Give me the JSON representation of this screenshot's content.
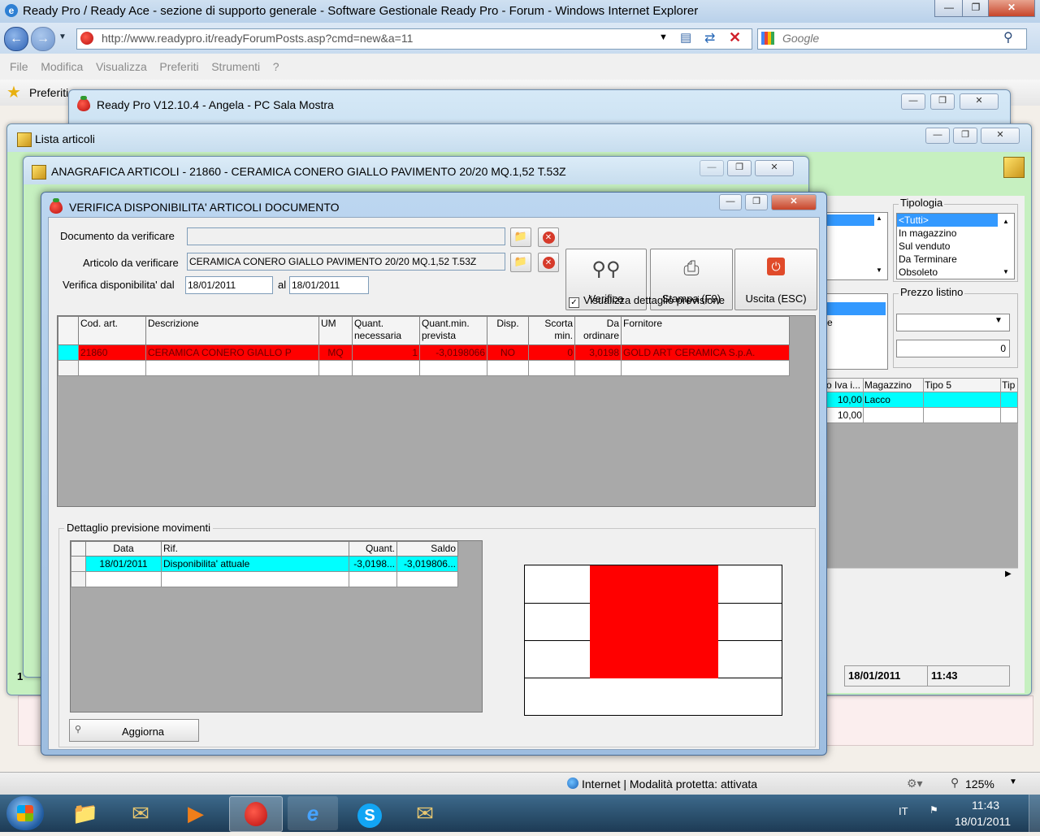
{
  "browser": {
    "title": "Ready Pro / Ready Ace - sezione di supporto generale - Software Gestionale Ready Pro - Forum - Windows Internet Explorer",
    "url": "http://www.readypro.it/readyForumPosts.asp?cmd=new&a=11",
    "search_placeholder": "Google",
    "menu": [
      "File",
      "Modifica",
      "Visualizza",
      "Preferiti",
      "Strumenti",
      "?"
    ],
    "favorites_label": "Preferiti",
    "status_zone": "Internet | Modalità protetta: attivata",
    "zoom": "125%"
  },
  "windows": {
    "main_app_title": "Ready Pro V12.10.4 - Angela - PC Sala Mostra",
    "list_title": "Lista articoli",
    "anagrafica_title": "ANAGRAFICA ARTICOLI - 21860 - CERAMICA CONERO GIALLO PAVIMENTO 20/20 MQ.1,52 T.53Z"
  },
  "background_list": {
    "tipologia_label": "Tipologia",
    "tipologia_options": [
      "<Tutti>",
      "In magazzino",
      "Sul venduto",
      "Da Terminare",
      "Obsoleto"
    ],
    "prezzo_listino_label": "Prezzo listino",
    "prezzo_value": "0",
    "columns": [
      "o Iva i...",
      "Magazzino",
      "Tipo 5",
      "Tip"
    ],
    "rows": [
      [
        "10,00",
        "Lacco",
        "",
        ""
      ],
      [
        "10,00",
        "",
        "",
        ""
      ]
    ],
    "footer_date": "18/01/2011",
    "footer_time": "11:43",
    "footer_left": "1"
  },
  "dialog": {
    "title": "VERIFICA DISPONIBILITA' ARTICOLI DOCUMENTO",
    "documento_label": "Documento da verificare",
    "documento_value": "",
    "articolo_label": "Articolo da verificare",
    "articolo_value": "CERAMICA CONERO GIALLO PAVIMENTO 20/20 MQ.1,52 T.53Z",
    "verifica_dal_label": "Verifica disponibilita' dal",
    "date_from": "18/01/2011",
    "al_label": "al",
    "date_to": "18/01/2011",
    "buttons": {
      "verifica": "Verifica",
      "stampa": "Stampa (F9)",
      "uscita": "Uscita (ESC)"
    },
    "visualizza_label": "Visualizza dettaglio previsione",
    "visualizza_checked": true,
    "grid_headers": [
      "Cod. art.",
      "Descrizione",
      "UM",
      "Quant. necessaria",
      "Quant.min. prevista",
      "Disp.",
      "Scorta min.",
      "Da ordinare",
      "Fornitore"
    ],
    "grid_row": {
      "cod": "21860",
      "descr": "CERAMICA CONERO GIALLO P",
      "um": "MQ",
      "quant": "1",
      "quant_min": "-3,0198066",
      "disp": "NO",
      "scorta": "0",
      "da_ordinare": "3,0198",
      "fornitore": "GOLD ART CERAMICA S.p.A."
    },
    "detail_group_label": "Dettaglio previsione movimenti",
    "detail_headers": [
      "Data",
      "Rif.",
      "Quant.",
      "Saldo"
    ],
    "detail_row": {
      "data": "18/01/2011",
      "rif": "Disponibilita' attuale",
      "quant": "-3,0198...",
      "saldo": "-3,019806..."
    },
    "aggiorna_label": "Aggiorna"
  },
  "taskbar": {
    "language": "IT",
    "time": "11:43",
    "date": "18/01/2011"
  },
  "colors": {
    "alert_red": "#ff0000",
    "highlight_cyan": "#00ffff",
    "list_select": "#3399ff"
  }
}
